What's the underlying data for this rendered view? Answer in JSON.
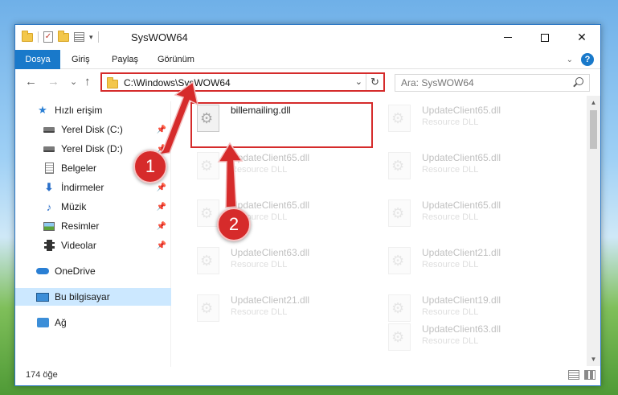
{
  "window": {
    "title": "SysWOW64",
    "controls": {
      "minimize": "—",
      "maximize": "☐",
      "close": "✕"
    }
  },
  "ribbon": {
    "tabs": [
      "Dosya",
      "Giriş",
      "Paylaş",
      "Görünüm"
    ],
    "help": "?"
  },
  "nav": {
    "back": "←",
    "forward": "→",
    "recent": "⌄",
    "up": "↑",
    "address": "C:\\Windows\\SysWOW64",
    "address_dropdown": "⌄",
    "refresh": "↻",
    "search_placeholder": "Ara: SysWOW64"
  },
  "sidebar": {
    "items": [
      {
        "label": "Hızlı erişim",
        "icon": "star-icon"
      },
      {
        "label": "Yerel Disk (C:)",
        "icon": "drive-icon",
        "pinned": true
      },
      {
        "label": "Yerel Disk (D:)",
        "icon": "drive-icon",
        "pinned": true
      },
      {
        "label": "Belgeler",
        "icon": "document-icon",
        "pinned": true
      },
      {
        "label": "İndirmeler",
        "icon": "download-icon",
        "pinned": true
      },
      {
        "label": "Müzik",
        "icon": "music-icon",
        "pinned": true
      },
      {
        "label": "Resimler",
        "icon": "pictures-icon",
        "pinned": true
      },
      {
        "label": "Videolar",
        "icon": "video-icon",
        "pinned": true
      },
      {
        "label": "OneDrive",
        "icon": "onedrive-icon"
      },
      {
        "label": "Bu bilgisayar",
        "icon": "computer-icon",
        "selected": true
      },
      {
        "label": "Ağ",
        "icon": "network-icon"
      }
    ]
  },
  "files": {
    "left": [
      {
        "name": "billemailing.dll",
        "type": ""
      },
      {
        "name": "UpdateClient65.dll",
        "type": "Resource DLL"
      },
      {
        "name": "UpdateClient65.dll",
        "type": "Resource DLL"
      },
      {
        "name": "UpdateClient63.dll",
        "type": "Resource DLL"
      },
      {
        "name": "UpdateClient21.dll",
        "type": "Resource DLL"
      }
    ],
    "right": [
      {
        "name": "UpdateClient65.dll",
        "type": "Resource DLL"
      },
      {
        "name": "UpdateClient65.dll",
        "type": "Resource DLL"
      },
      {
        "name": "UpdateClient65.dll",
        "type": "Resource DLL"
      },
      {
        "name": "UpdateClient21.dll",
        "type": "Resource DLL"
      },
      {
        "name": "UpdateClient19.dll",
        "type": "Resource DLL"
      },
      {
        "name": "UpdateClient63.dll",
        "type": "Resource DLL"
      }
    ]
  },
  "status": {
    "count": "174 öğe"
  },
  "annotations": {
    "step1": "1",
    "step2": "2",
    "color": "#d62b2b"
  }
}
